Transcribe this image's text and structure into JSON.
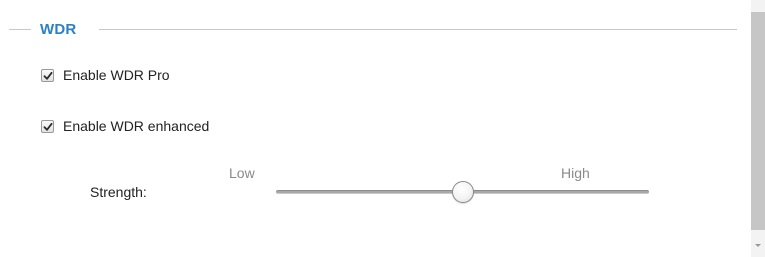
{
  "section": {
    "title": "WDR"
  },
  "options": [
    {
      "label": "Enable WDR Pro",
      "checked": true
    },
    {
      "label": "Enable WDR enhanced",
      "checked": true
    }
  ],
  "strength": {
    "label": "Strength:",
    "low_label": "Low",
    "high_label": "High",
    "value_fraction": 0.5
  },
  "colors": {
    "accent": "#2a7fc9",
    "divider": "#c8c8c8",
    "muted_text": "#8a8a8a"
  },
  "icons": {
    "checkbox_mark": "checkmark-icon",
    "scroll_down": "chevron-down-icon"
  }
}
